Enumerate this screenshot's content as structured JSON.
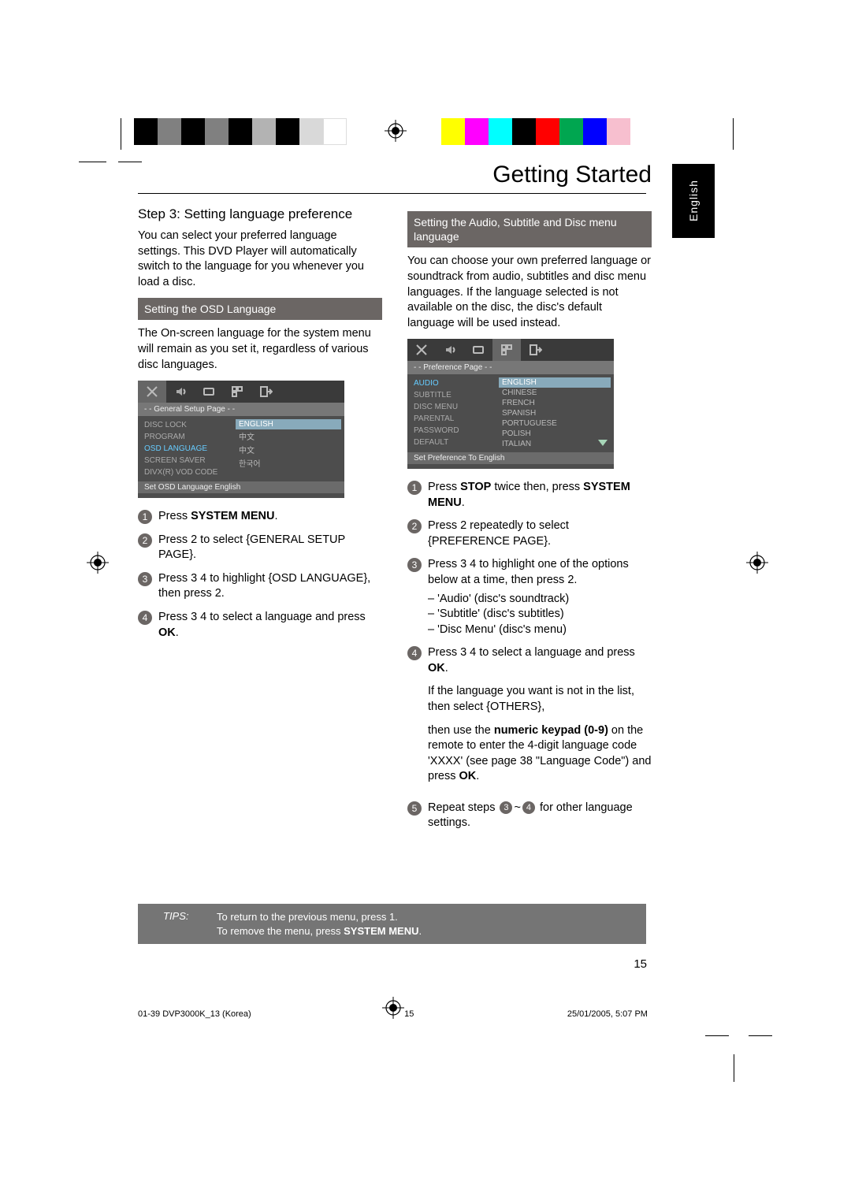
{
  "header": {
    "title": "Getting Started"
  },
  "sideTab": "English",
  "left": {
    "stepTitle": "Step 3:  Setting language preference",
    "intro": "You can select your preferred language settings. This DVD Player will automatically switch to the language for you whenever you load a disc.",
    "sectionHeading": "Setting the OSD Language",
    "osdExplain": "The On-screen language for the system menu will remain as you set it, regardless of various disc languages.",
    "menu": {
      "title": "- - General Setup Page - -",
      "items": [
        "DISC LOCK",
        "PROGRAM",
        "OSD LANGUAGE",
        "SCREEN SAVER",
        "DIVX(R) VOD CODE"
      ],
      "rightHighlight": "ENGLISH",
      "rightOptions": [
        "中文",
        "中文",
        "한국어"
      ],
      "footer": "Set OSD Language English"
    },
    "steps": {
      "s1a": "Press ",
      "s1b": "SYSTEM MENU",
      "s1c": ".",
      "s2": "Press  2  to select {GENERAL SETUP PAGE}.",
      "s3": "Press  3 4  to highlight {OSD LANGUAGE}, then press  2.",
      "s4a": "Press  3 4  to select a language and press ",
      "s4b": "OK",
      "s4c": "."
    }
  },
  "right": {
    "sectionHeading": "Setting the Audio, Subtitle and Disc menu language",
    "intro": "You can choose your own preferred language or soundtrack from audio, subtitles and disc menu languages. If the language selected is not available on the disc, the disc's default language will be used instead.",
    "menu": {
      "title": "- - Preference Page - -",
      "items": [
        "AUDIO",
        "SUBTITLE",
        "DISC MENU",
        "PARENTAL",
        "PASSWORD",
        "DEFAULT"
      ],
      "rightHighlight": "ENGLISH",
      "rightOptions": [
        "CHINESE",
        "FRENCH",
        "SPANISH",
        "PORTUGUESE",
        "POLISH",
        "ITALIAN"
      ],
      "footer": "Set Preference To English"
    },
    "steps": {
      "s1a": "Press ",
      "s1b": "STOP",
      "s1c": " twice then, press ",
      "s1d": "SYSTEM MENU",
      "s1e": ".",
      "s2": "Press  2  repeatedly to select {PREFERENCE PAGE}.",
      "s3_lead": "Press  3 4  to highlight one of the options below at a time, then press  2.",
      "s3_opts": [
        "–  'Audio' (disc's soundtrack)",
        "–  'Subtitle' (disc's subtitles)",
        "–  'Disc Menu' (disc's menu)"
      ],
      "s4a": "Press  3 4  to select a language and press ",
      "s4b": "OK",
      "s4c": ".",
      "s4_para1": "If the language you want is not in the list, then select {OTHERS},",
      "s4_para2a": "then use the ",
      "s4_para2b": "numeric keypad (0-9)",
      "s4_para2c": " on the remote to enter the 4-digit language code 'XXXX' (see page 38 \"Language Code\") and press ",
      "s4_para2d": "OK",
      "s4_para2e": ".",
      "s5a": "Repeat steps ",
      "s5b": "~",
      "s5c": " for other language settings."
    }
  },
  "tips": {
    "label": "TIPS:",
    "line1": "To return to the previous menu, press  1.",
    "line2a": "To remove the menu, press ",
    "line2b": "SYSTEM MENU",
    "line2c": "."
  },
  "pageNumber": "15",
  "footer": {
    "file": "01-39 DVP3000K_13 (Korea)",
    "pg": "15",
    "timestamp": "25/01/2005, 5:07 PM"
  },
  "colorbars": {
    "left": [
      "#000",
      "#666",
      "#000",
      "#666",
      "#000",
      "#666",
      "#000",
      "#666",
      "#fff"
    ],
    "right": [
      "#ffff00",
      "#ff00ff",
      "#00ffff",
      "#000",
      "#ff0000",
      "#00a650",
      "#ffc0cb",
      "#7db9e8"
    ]
  }
}
